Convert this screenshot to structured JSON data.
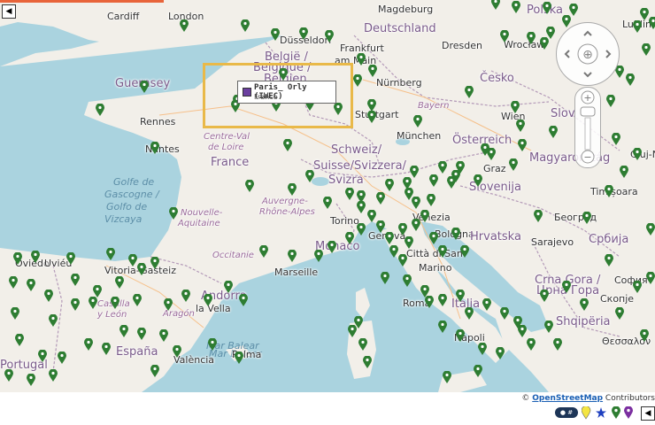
{
  "colors": {
    "accent": "#e9b949",
    "marker": "#2e7d32",
    "water": "#aad3df",
    "land": "#f2efe9"
  },
  "popup": {
    "title": "Paris_ Orly (IWEC)",
    "subtitle": "France",
    "swatch_color": "#6b3fa0"
  },
  "attribution": {
    "prefix": "© ",
    "link": "OpenStreetMap",
    "suffix": " Contributors"
  },
  "legend": {
    "toggle_label": "● #",
    "icons": [
      "yellow-marker-icon",
      "blue-star-icon",
      "green-marker-icon",
      "purple-marker-icon"
    ]
  },
  "nav": {
    "left_arrow": "◀",
    "right_arrow": "◀"
  },
  "map_labels": [
    {
      "text": "Cardiff",
      "kind": "city"
    },
    {
      "text": "London",
      "kind": "city"
    },
    {
      "text": "Magdeburg",
      "kind": "city"
    },
    {
      "text": "Polska",
      "kind": "country"
    },
    {
      "text": "Lublin",
      "kind": "city"
    },
    {
      "text": "Deutschland",
      "kind": "country"
    },
    {
      "text": "Düsseldorf",
      "kind": "city"
    },
    {
      "text": "België /",
      "kind": "country"
    },
    {
      "text": "Belgique /",
      "kind": "country"
    },
    {
      "text": "Belgien",
      "kind": "country"
    },
    {
      "text": "Frankfurt",
      "kind": "city"
    },
    {
      "text": "am Main",
      "kind": "city"
    },
    {
      "text": "Dresden",
      "kind": "city"
    },
    {
      "text": "Wrocław",
      "kind": "city"
    },
    {
      "text": "Guernsey",
      "kind": "country"
    },
    {
      "text": "Nürnberg",
      "kind": "city"
    },
    {
      "text": "Česko",
      "kind": "country"
    },
    {
      "text": "Rennes",
      "kind": "city"
    },
    {
      "text": "Bayern",
      "kind": "region"
    },
    {
      "text": "Stuttgart",
      "kind": "city"
    },
    {
      "text": "Wien",
      "kind": "city"
    },
    {
      "text": "Slov",
      "kind": "country"
    },
    {
      "text": "Centre-Val",
      "kind": "region"
    },
    {
      "text": "de Loire",
      "kind": "region"
    },
    {
      "text": "München",
      "kind": "city"
    },
    {
      "text": "Österreich",
      "kind": "country"
    },
    {
      "text": "Nantes",
      "kind": "city"
    },
    {
      "text": "France",
      "kind": "country"
    },
    {
      "text": "Schweiz/",
      "kind": "country"
    },
    {
      "text": "Suisse/Svizzera/",
      "kind": "country"
    },
    {
      "text": "Svizra",
      "kind": "country"
    },
    {
      "text": "Graz",
      "kind": "city"
    },
    {
      "text": "Magyarország",
      "kind": "country"
    },
    {
      "text": "Cluj-N",
      "kind": "city"
    },
    {
      "text": "Golfe de",
      "kind": "sea"
    },
    {
      "text": "Gascogne /",
      "kind": "sea"
    },
    {
      "text": "Golfo de",
      "kind": "sea"
    },
    {
      "text": "Vizcaya",
      "kind": "sea"
    },
    {
      "text": "Auvergne-",
      "kind": "region"
    },
    {
      "text": "Rhône-Alpes",
      "kind": "region"
    },
    {
      "text": "Nouvelle-",
      "kind": "region"
    },
    {
      "text": "Aquitaine",
      "kind": "region"
    },
    {
      "text": "Slovenija",
      "kind": "country"
    },
    {
      "text": "Timișoara",
      "kind": "city"
    },
    {
      "text": "Torino",
      "kind": "city"
    },
    {
      "text": "Venezia",
      "kind": "city"
    },
    {
      "text": "Београд",
      "kind": "city"
    },
    {
      "text": "Monaco",
      "kind": "country"
    },
    {
      "text": "Genova",
      "kind": "city"
    },
    {
      "text": "Bologna",
      "kind": "city"
    },
    {
      "text": "Hrvatska",
      "kind": "country"
    },
    {
      "text": "Sarajevo",
      "kind": "city"
    },
    {
      "text": "Србија",
      "kind": "country"
    },
    {
      "text": "Oviedo",
      "kind": "city"
    },
    {
      "text": "Uviéu",
      "kind": "city"
    },
    {
      "text": "Occitanie",
      "kind": "region"
    },
    {
      "text": "Marseille",
      "kind": "city"
    },
    {
      "text": "Città di San",
      "kind": "city"
    },
    {
      "text": "Marino",
      "kind": "city"
    },
    {
      "text": "Vitoria-Gasteiz",
      "kind": "city"
    },
    {
      "text": "Andorra",
      "kind": "country"
    },
    {
      "text": "la Vella",
      "kind": "city"
    },
    {
      "text": "Crna Gora /",
      "kind": "country"
    },
    {
      "text": "Црна Гора",
      "kind": "country"
    },
    {
      "text": "София",
      "kind": "city"
    },
    {
      "text": "Castilla",
      "kind": "region"
    },
    {
      "text": "y León",
      "kind": "region"
    },
    {
      "text": "Aragón",
      "kind": "region"
    },
    {
      "text": "Roma",
      "kind": "city"
    },
    {
      "text": "Italia",
      "kind": "country"
    },
    {
      "text": "Скопје",
      "kind": "city"
    },
    {
      "text": "Shqipëria",
      "kind": "country"
    },
    {
      "text": "Mar Balear",
      "kind": "sea"
    },
    {
      "text": "Mar Balear",
      "kind": "sea"
    },
    {
      "text": "España",
      "kind": "country"
    },
    {
      "text": "Napoli",
      "kind": "city"
    },
    {
      "text": "Palma",
      "kind": "city"
    },
    {
      "text": "València",
      "kind": "city"
    },
    {
      "text": "Portugal",
      "kind": "country"
    },
    {
      "text": "Θεσσαλον",
      "kind": "city"
    }
  ]
}
